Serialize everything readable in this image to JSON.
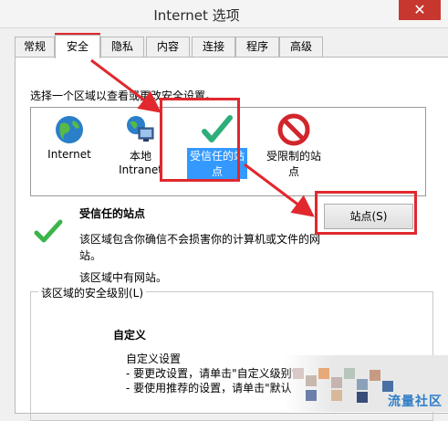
{
  "window": {
    "title": "Internet 选项",
    "close_glyph": "✕"
  },
  "tabs": [
    {
      "label": "常规"
    },
    {
      "label": "安全"
    },
    {
      "label": "隐私"
    },
    {
      "label": "内容"
    },
    {
      "label": "连接"
    },
    {
      "label": "程序"
    },
    {
      "label": "高级"
    }
  ],
  "active_tab": "安全",
  "security": {
    "zone_prompt": "选择一个区域以查看或更改安全设置。",
    "zones": [
      {
        "label": "Internet",
        "icon": "globe-icon"
      },
      {
        "label": "本地\nIntranet",
        "icon": "intranet-icon"
      },
      {
        "label": "受信任的站\n点",
        "icon": "checkmark-icon"
      },
      {
        "label": "受限制的站\n点",
        "icon": "no-entry-icon"
      }
    ],
    "selected_zone": "受信任的站点",
    "detail": {
      "title": "受信任的站点",
      "description": "该区域包含你确信不会损害你的计算机或文件的网站。",
      "no_sites": "该区域中有网站。"
    },
    "sites_button": "站点(S)",
    "security_level_label": "该区域的安全级别(L)",
    "custom": {
      "title": "自定义",
      "line1": "自定义设置",
      "line2": "- 要更改设置，请单击\"自定义级别\"",
      "line3": "- 要使用推荐的设置，请单击\"默认"
    }
  },
  "watermark": {
    "text": "流量社区"
  },
  "colors": {
    "highlight": "#3399ff",
    "annotation_red": "#e0282e",
    "close_red": "#c7372f"
  }
}
